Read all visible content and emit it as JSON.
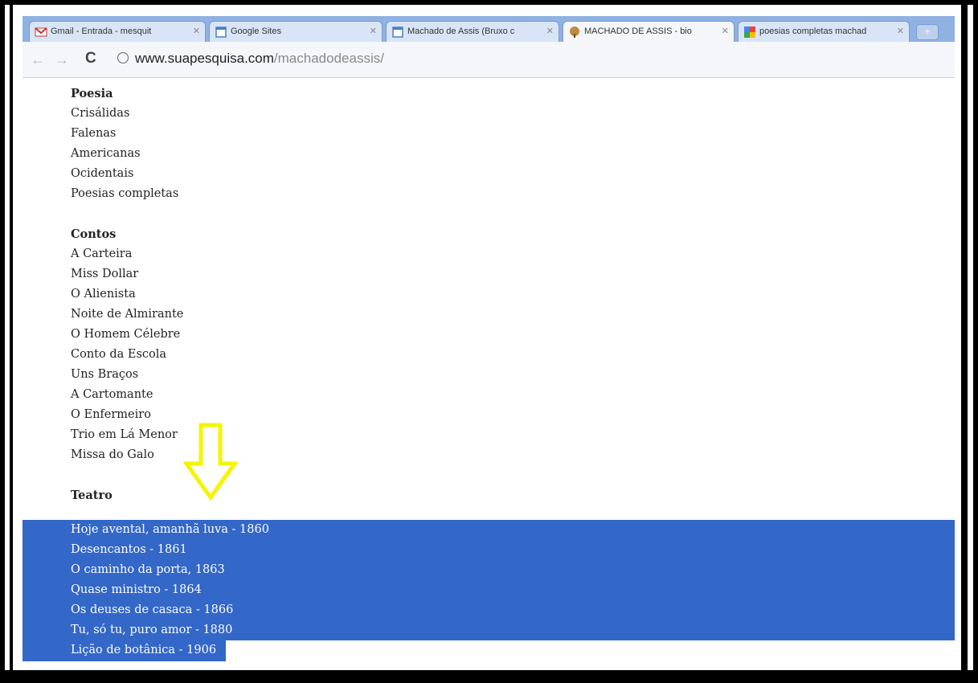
{
  "browser": {
    "tabs": [
      {
        "label": "Gmail - Entrada - mesquit",
        "icon": "gmail-icon",
        "active": false
      },
      {
        "label": "Google Sites",
        "icon": "page-icon",
        "active": false
      },
      {
        "label": "Machado de Assis (Bruxo c",
        "icon": "page-icon",
        "active": false
      },
      {
        "label": "MACHADO DE ASSIS - bio",
        "icon": "site-favicon",
        "active": true
      },
      {
        "label": "poesias completas machad",
        "icon": "google-icon",
        "active": false
      }
    ],
    "new_tab": "+",
    "address": {
      "domain": "www.suapesquisa.com",
      "path": "/machadodeassis/"
    }
  },
  "page": {
    "sections": {
      "poesia": {
        "title": "Poesia",
        "items": [
          "Crisálidas",
          "Falenas",
          "Americanas",
          "Ocidentais",
          "Poesias completas"
        ]
      },
      "contos": {
        "title": "Contos",
        "items": [
          "A Carteira",
          "Miss Dollar",
          "O Alienista",
          "Noite de Almirante",
          "O Homem Célebre",
          "Conto da Escola",
          "Uns Braços",
          "A Cartomante",
          "O Enfermeiro",
          "Trio em Lá Menor",
          "Missa do Galo"
        ]
      },
      "teatro": {
        "title": "Teatro",
        "items": [
          "Hoje avental, amanhã luva - 1860",
          "Desencantos - 1861",
          "O caminho da porta, 1863",
          "Quase ministro - 1864",
          "Os deuses de casaca - 1866",
          "Tu, só tu, puro amor - 1880",
          "Lição de botânica - 1906"
        ]
      }
    },
    "colors": {
      "selection": "#3367c8",
      "annotation_arrow": "#f5f500"
    }
  }
}
